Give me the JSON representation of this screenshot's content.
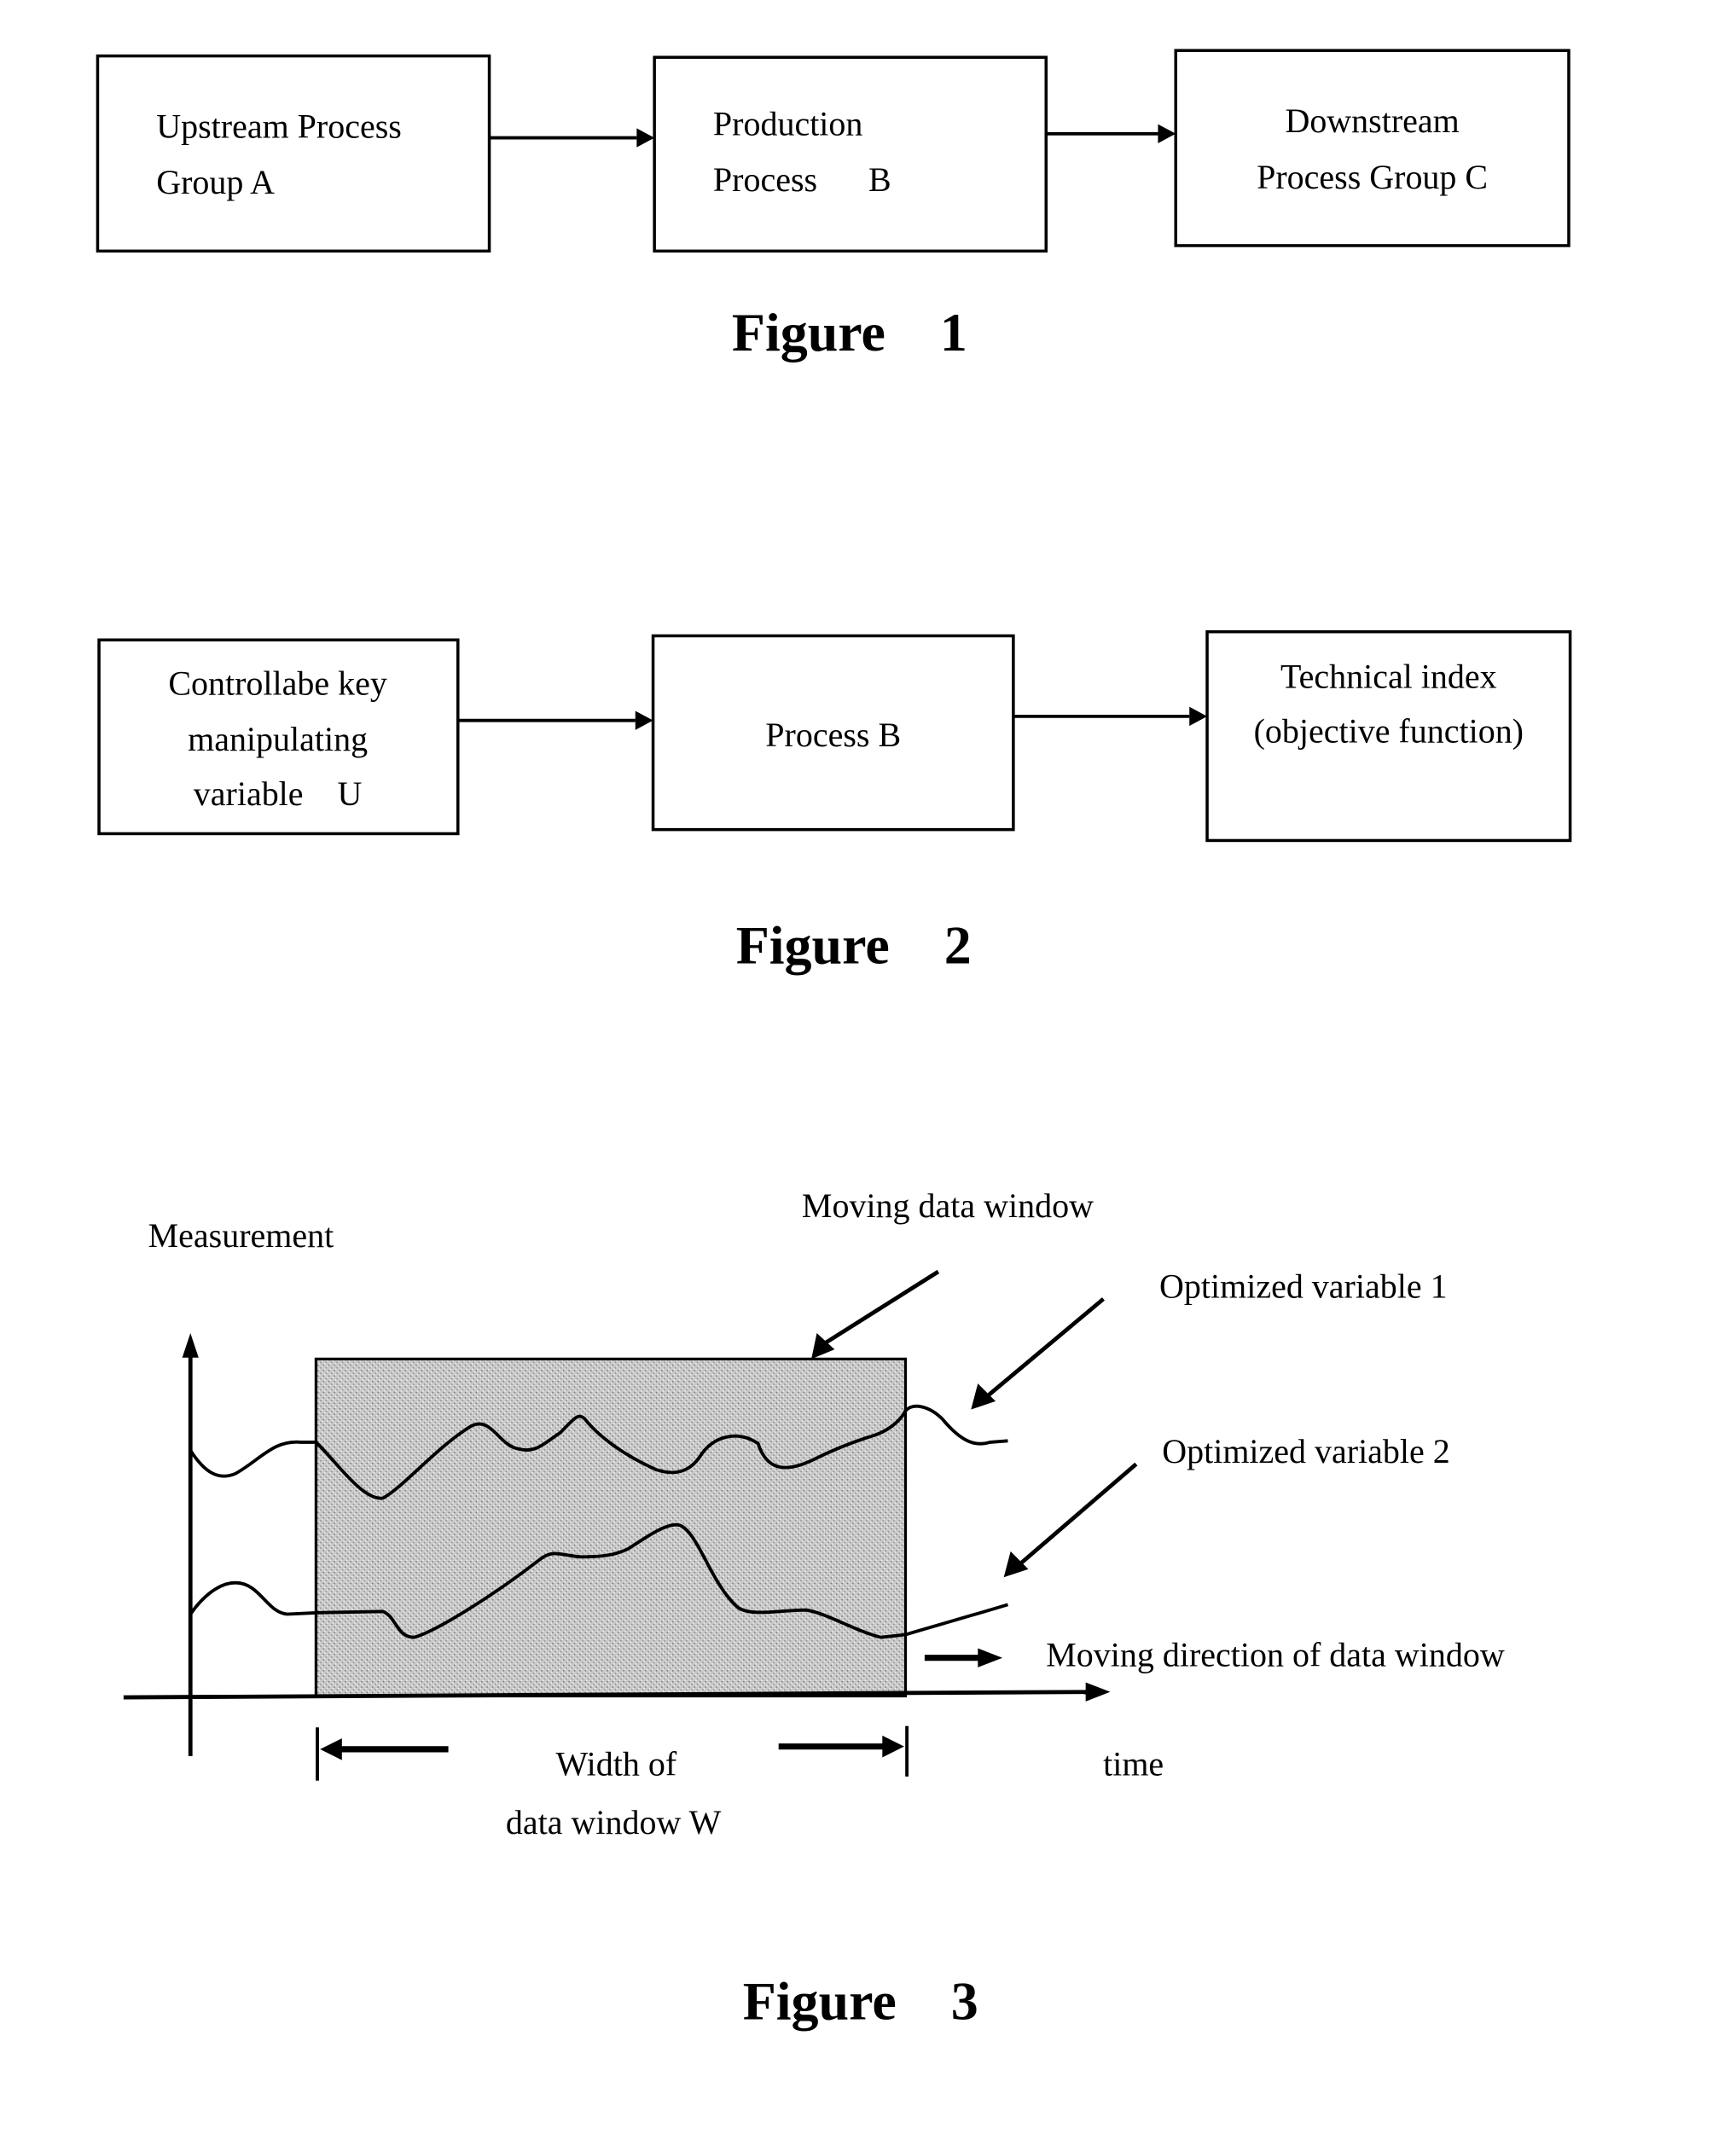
{
  "figure1": {
    "caption": "Figure    1",
    "boxes": [
      {
        "lines": [
          "Upstream Process",
          "Group A"
        ]
      },
      {
        "lines": [
          "Production",
          "Process      B"
        ]
      },
      {
        "lines": [
          "Downstream",
          "Process Group C"
        ]
      }
    ]
  },
  "figure2": {
    "caption": "Figure    2",
    "boxes": [
      {
        "lines": [
          "Controllabe key",
          "manipulating",
          "variable    U"
        ]
      },
      {
        "lines": [
          "Process B"
        ]
      },
      {
        "lines": [
          "Technical index",
          "(objective function)"
        ]
      }
    ]
  },
  "figure3": {
    "caption": "Figure    3",
    "y_axis_label": "Measurement",
    "x_axis_label": "time",
    "window_label": "Moving data window",
    "series_labels": [
      "Optimized variable 1",
      "Optimized variable 2"
    ],
    "direction_label": "Moving direction of data window",
    "width_label": [
      "Width of",
      "data window W"
    ]
  }
}
